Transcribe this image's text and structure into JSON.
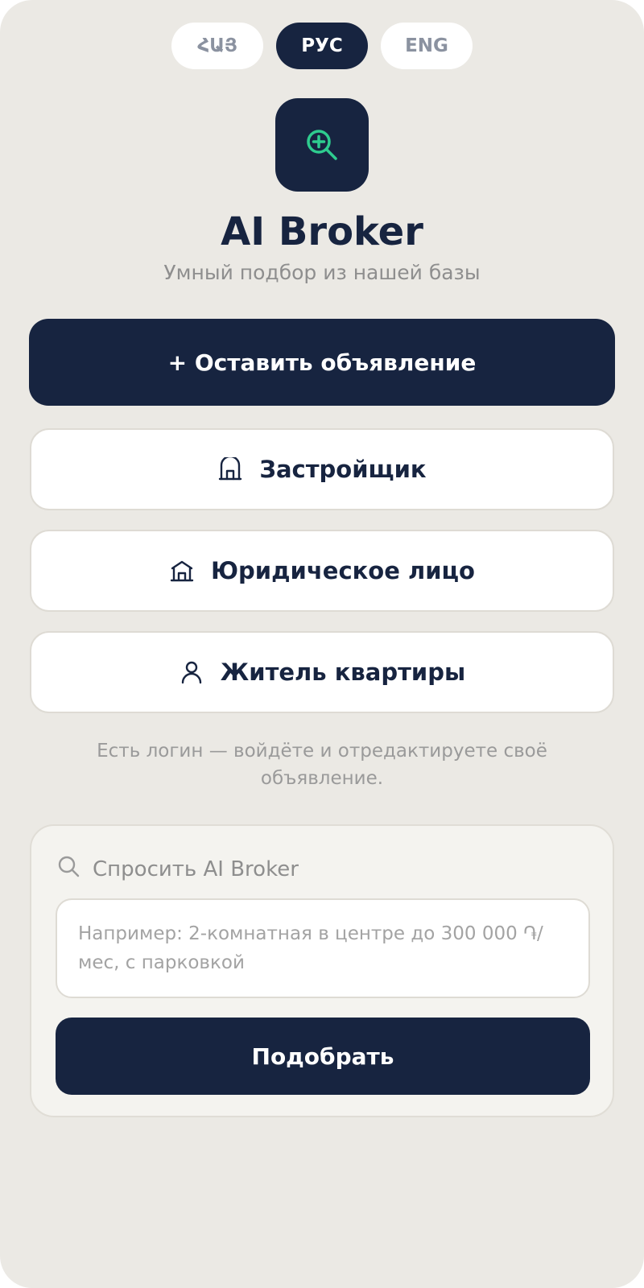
{
  "languages": [
    {
      "label": "ՀԱՅ",
      "active": false
    },
    {
      "label": "РУС",
      "active": true
    },
    {
      "label": "ENG",
      "active": false
    }
  ],
  "logo": {
    "icon": "search-plus-icon",
    "icon_color": "#2ecc8f",
    "tile_color": "#172440"
  },
  "app": {
    "title": "AI Broker",
    "subtitle": "Умный подбор из нашей базы"
  },
  "primary_action": {
    "label": "+ Оставить объявление"
  },
  "roles": [
    {
      "label": "Застройщик",
      "icon": "building-icon"
    },
    {
      "label": "Юридическое лицо",
      "icon": "bank-icon"
    },
    {
      "label": "Житель квартиры",
      "icon": "user-icon"
    }
  ],
  "login_hint": "Есть логин — войдёте и отредактируете своё объявление.",
  "ask": {
    "header": "Спросить AI Broker",
    "header_icon": "search-icon",
    "placeholder": "Например: 2-комнатная в центре до 300 000 ֏/мес, с парковкой",
    "submit_label": "Подобрать"
  },
  "colors": {
    "navy": "#172440",
    "background": "#ebe9e4",
    "accent": "#2ecc8f"
  }
}
